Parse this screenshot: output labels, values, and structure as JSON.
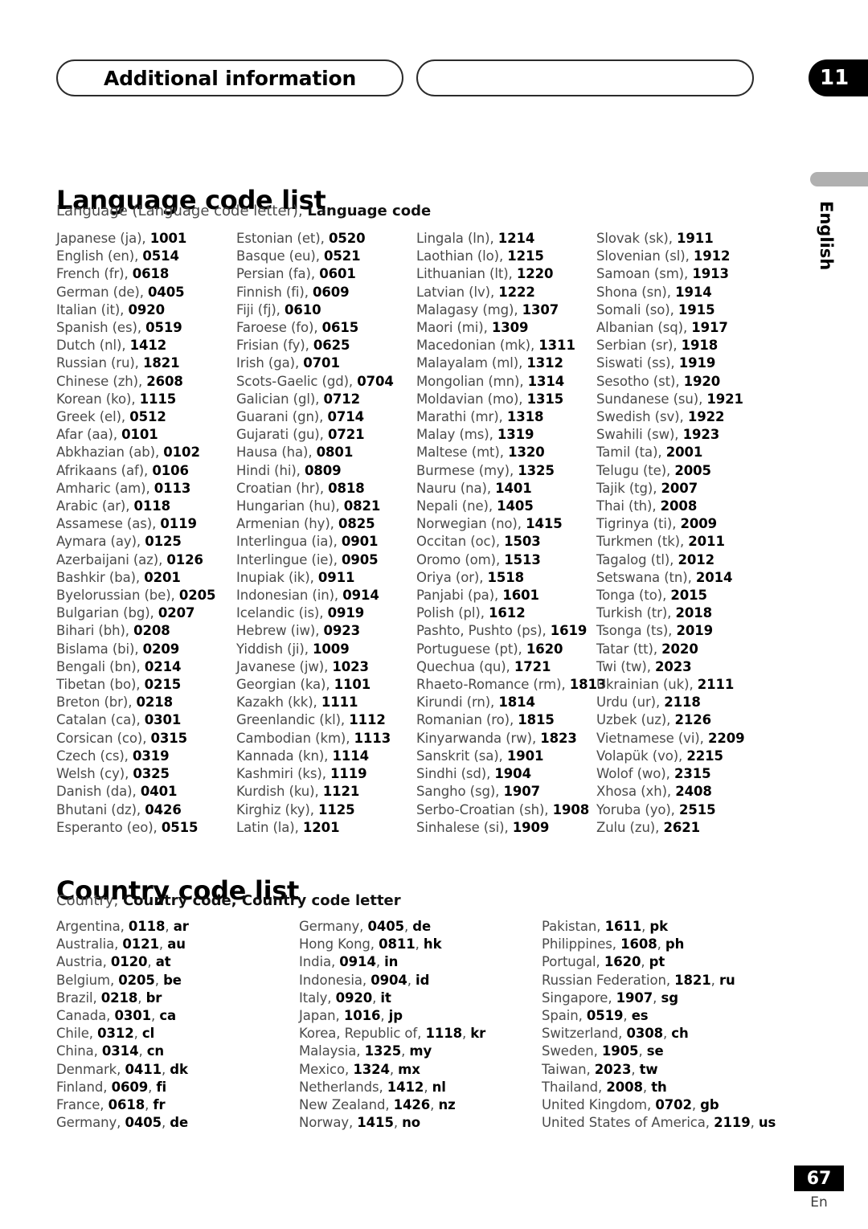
{
  "header": {
    "chapter_label": "Additional information",
    "chapter_number": "11"
  },
  "side_tab": {
    "label": "English"
  },
  "language_section": {
    "title": "Language code list",
    "subtitle_plain": "Language (Language code letter), ",
    "subtitle_bold": "Language code",
    "columns": [
      [
        {
          "name": "Japanese (ja), ",
          "code": "1001"
        },
        {
          "name": "English (en), ",
          "code": "0514"
        },
        {
          "name": "French (fr), ",
          "code": "0618"
        },
        {
          "name": "German (de), ",
          "code": "0405"
        },
        {
          "name": "Italian (it), ",
          "code": "0920"
        },
        {
          "name": "Spanish (es), ",
          "code": "0519"
        },
        {
          "name": "Dutch (nl), ",
          "code": "1412"
        },
        {
          "name": "Russian (ru), ",
          "code": "1821"
        },
        {
          "name": "Chinese (zh), ",
          "code": "2608"
        },
        {
          "name": "Korean (ko), ",
          "code": "1115"
        },
        {
          "name": "Greek (el), ",
          "code": "0512"
        },
        {
          "name": "Afar (aa), ",
          "code": "0101"
        },
        {
          "name": "Abkhazian (ab), ",
          "code": "0102"
        },
        {
          "name": "Afrikaans (af), ",
          "code": "0106"
        },
        {
          "name": "Amharic (am), ",
          "code": "0113"
        },
        {
          "name": "Arabic (ar), ",
          "code": "0118"
        },
        {
          "name": "Assamese (as), ",
          "code": "0119"
        },
        {
          "name": "Aymara (ay), ",
          "code": "0125"
        },
        {
          "name": "Azerbaijani (az), ",
          "code": "0126"
        },
        {
          "name": "Bashkir (ba), ",
          "code": "0201"
        },
        {
          "name": "Byelorussian (be), ",
          "code": "0205"
        },
        {
          "name": "Bulgarian (bg), ",
          "code": "0207"
        },
        {
          "name": "Bihari (bh), ",
          "code": "0208"
        },
        {
          "name": "Bislama (bi), ",
          "code": "0209"
        },
        {
          "name": "Bengali (bn), ",
          "code": "0214"
        },
        {
          "name": "Tibetan (bo), ",
          "code": "0215"
        },
        {
          "name": "Breton (br), ",
          "code": "0218"
        },
        {
          "name": "Catalan (ca), ",
          "code": "0301"
        },
        {
          "name": "Corsican (co), ",
          "code": "0315"
        },
        {
          "name": "Czech (cs), ",
          "code": "0319"
        },
        {
          "name": "Welsh (cy), ",
          "code": "0325"
        },
        {
          "name": "Danish (da), ",
          "code": "0401"
        },
        {
          "name": "Bhutani (dz), ",
          "code": "0426"
        },
        {
          "name": "Esperanto (eo), ",
          "code": "0515"
        }
      ],
      [
        {
          "name": "Estonian (et), ",
          "code": "0520"
        },
        {
          "name": "Basque (eu), ",
          "code": "0521"
        },
        {
          "name": "Persian (fa), ",
          "code": "0601"
        },
        {
          "name": "Finnish (fi), ",
          "code": "0609"
        },
        {
          "name": "Fiji (fj), ",
          "code": "0610"
        },
        {
          "name": "Faroese (fo), ",
          "code": "0615"
        },
        {
          "name": "Frisian (fy), ",
          "code": "0625"
        },
        {
          "name": "Irish (ga), ",
          "code": "0701"
        },
        {
          "name": "Scots-Gaelic (gd), ",
          "code": "0704"
        },
        {
          "name": "Galician (gl), ",
          "code": "0712"
        },
        {
          "name": "Guarani (gn), ",
          "code": "0714"
        },
        {
          "name": "Gujarati (gu), ",
          "code": "0721"
        },
        {
          "name": "Hausa (ha), ",
          "code": "0801"
        },
        {
          "name": "Hindi (hi), ",
          "code": "0809"
        },
        {
          "name": "Croatian (hr), ",
          "code": "0818"
        },
        {
          "name": "Hungarian (hu), ",
          "code": "0821"
        },
        {
          "name": "Armenian (hy), ",
          "code": "0825"
        },
        {
          "name": "Interlingua (ia), ",
          "code": "0901"
        },
        {
          "name": "Interlingue (ie), ",
          "code": "0905"
        },
        {
          "name": "Inupiak (ik), ",
          "code": "0911"
        },
        {
          "name": "Indonesian (in), ",
          "code": "0914"
        },
        {
          "name": "Icelandic (is), ",
          "code": "0919"
        },
        {
          "name": "Hebrew (iw), ",
          "code": "0923"
        },
        {
          "name": "Yiddish (ji), ",
          "code": "1009"
        },
        {
          "name": "Javanese (jw), ",
          "code": "1023"
        },
        {
          "name": "Georgian (ka), ",
          "code": "1101"
        },
        {
          "name": "Kazakh (kk), ",
          "code": "1111"
        },
        {
          "name": "Greenlandic  (kl), ",
          "code": "1112"
        },
        {
          "name": "Cambodian (km), ",
          "code": "1113"
        },
        {
          "name": "Kannada (kn), ",
          "code": "1114"
        },
        {
          "name": "Kashmiri (ks), ",
          "code": "1119"
        },
        {
          "name": "Kurdish (ku), ",
          "code": "1121"
        },
        {
          "name": "Kirghiz (ky), ",
          "code": "1125"
        },
        {
          "name": "Latin (la), ",
          "code": "1201"
        }
      ],
      [
        {
          "name": "Lingala (ln), ",
          "code": "1214"
        },
        {
          "name": "Laothian (lo), ",
          "code": "1215"
        },
        {
          "name": "Lithuanian (lt), ",
          "code": "1220"
        },
        {
          "name": "Latvian (lv), ",
          "code": "1222"
        },
        {
          "name": "Malagasy (mg), ",
          "code": "1307"
        },
        {
          "name": "Maori (mi), ",
          "code": "1309"
        },
        {
          "name": "Macedonian (mk), ",
          "code": "1311"
        },
        {
          "name": "Malayalam  (ml), ",
          "code": "1312"
        },
        {
          "name": "Mongolian (mn), ",
          "code": "1314"
        },
        {
          "name": "Moldavian (mo), ",
          "code": "1315"
        },
        {
          "name": "Marathi (mr), ",
          "code": "1318"
        },
        {
          "name": "Malay  (ms), ",
          "code": "1319"
        },
        {
          "name": "Maltese (mt), ",
          "code": "1320"
        },
        {
          "name": "Burmese (my), ",
          "code": "1325"
        },
        {
          "name": "Nauru (na), ",
          "code": "1401"
        },
        {
          "name": "Nepali (ne), ",
          "code": "1405"
        },
        {
          "name": "Norwegian (no), ",
          "code": "1415"
        },
        {
          "name": "Occitan (oc), ",
          "code": "1503"
        },
        {
          "name": "Oromo (om), ",
          "code": "1513"
        },
        {
          "name": "Oriya (or), ",
          "code": "1518"
        },
        {
          "name": "Panjabi (pa), ",
          "code": "1601"
        },
        {
          "name": "Polish (pl), ",
          "code": "1612"
        },
        {
          "name": "Pashto, Pushto (ps), ",
          "code": "1619"
        },
        {
          "name": "Portuguese (pt), ",
          "code": "1620"
        },
        {
          "name": "Quechua (qu), ",
          "code": "1721"
        },
        {
          "name": "Rhaeto-Romance (rm), ",
          "code": "1813"
        },
        {
          "name": "Kirundi (rn), ",
          "code": "1814"
        },
        {
          "name": "Romanian (ro), ",
          "code": "1815"
        },
        {
          "name": "Kinyarwanda (rw), ",
          "code": "1823"
        },
        {
          "name": "Sanskrit (sa), ",
          "code": "1901"
        },
        {
          "name": "Sindhi (sd), ",
          "code": "1904"
        },
        {
          "name": "Sangho (sg), ",
          "code": "1907"
        },
        {
          "name": "Serbo-Croatian (sh), ",
          "code": "1908"
        },
        {
          "name": "Sinhalese (si), ",
          "code": "1909"
        }
      ],
      [
        {
          "name": "Slovak (sk), ",
          "code": "1911"
        },
        {
          "name": "Slovenian (sl), ",
          "code": "1912"
        },
        {
          "name": "Samoan (sm), ",
          "code": "1913"
        },
        {
          "name": "Shona (sn), ",
          "code": "1914"
        },
        {
          "name": "Somali (so), ",
          "code": "1915"
        },
        {
          "name": "Albanian (sq), ",
          "code": "1917"
        },
        {
          "name": "Serbian (sr), ",
          "code": "1918"
        },
        {
          "name": "Siswati (ss), ",
          "code": "1919"
        },
        {
          "name": "Sesotho (st), ",
          "code": "1920"
        },
        {
          "name": "Sundanese (su), ",
          "code": "1921"
        },
        {
          "name": "Swedish (sv), ",
          "code": "1922"
        },
        {
          "name": "Swahili (sw), ",
          "code": "1923"
        },
        {
          "name": "Tamil (ta), ",
          "code": "2001"
        },
        {
          "name": "Telugu (te), ",
          "code": "2005"
        },
        {
          "name": "Tajik (tg), ",
          "code": "2007"
        },
        {
          "name": "Thai (th), ",
          "code": "2008"
        },
        {
          "name": "Tigrinya (ti), ",
          "code": "2009"
        },
        {
          "name": "Turkmen (tk), ",
          "code": "2011"
        },
        {
          "name": "Tagalog (tl), ",
          "code": "2012"
        },
        {
          "name": "Setswana (tn), ",
          "code": "2014"
        },
        {
          "name": "Tonga (to), ",
          "code": "2015"
        },
        {
          "name": "Turkish (tr), ",
          "code": "2018"
        },
        {
          "name": "Tsonga (ts), ",
          "code": "2019"
        },
        {
          "name": "Tatar (tt), ",
          "code": "2020"
        },
        {
          "name": "Twi (tw), ",
          "code": "2023"
        },
        {
          "name": "Ukrainian (uk), ",
          "code": "2111"
        },
        {
          "name": "Urdu (ur), ",
          "code": "2118"
        },
        {
          "name": "Uzbek (uz), ",
          "code": "2126"
        },
        {
          "name": "Vietnamese (vi), ",
          "code": "2209"
        },
        {
          "name": "Volapük (vo), ",
          "code": "2215"
        },
        {
          "name": "Wolof (wo), ",
          "code": "2315"
        },
        {
          "name": "Xhosa (xh), ",
          "code": "2408"
        },
        {
          "name": "Yoruba (yo), ",
          "code": "2515"
        },
        {
          "name": "Zulu (zu), ",
          "code": "2621"
        }
      ]
    ]
  },
  "country_section": {
    "title": "Country code list",
    "subtitle_plain": "Country, ",
    "subtitle_bold": "Country code, Country code letter",
    "columns": [
      [
        {
          "name": "Argentina, ",
          "code": "0118",
          "letter": "ar"
        },
        {
          "name": "Australia, ",
          "code": "0121",
          "letter": "au"
        },
        {
          "name": "Austria, ",
          "code": "0120",
          "letter": "at"
        },
        {
          "name": "Belgium, ",
          "code": "0205",
          "letter": "be"
        },
        {
          "name": "Brazil, ",
          "code": "0218",
          "letter": "br"
        },
        {
          "name": "Canada, ",
          "code": "0301",
          "letter": "ca"
        },
        {
          "name": "Chile, ",
          "code": "0312",
          "letter": "cl"
        },
        {
          "name": "China, ",
          "code": "0314",
          "letter": "cn"
        },
        {
          "name": "Denmark, ",
          "code": "0411",
          "letter": "dk"
        },
        {
          "name": "Finland, ",
          "code": "0609",
          "letter": "fi"
        },
        {
          "name": "France, ",
          "code": "0618",
          "letter": "fr"
        },
        {
          "name": "Germany, ",
          "code": "0405",
          "letter": "de"
        }
      ],
      [
        {
          "name": "Germany, ",
          "code": "0405",
          "letter": "de"
        },
        {
          "name": "Hong Kong, ",
          "code": "0811",
          "letter": "hk"
        },
        {
          "name": "India, ",
          "code": "0914",
          "letter": "in"
        },
        {
          "name": "Indonesia, ",
          "code": "0904",
          "letter": "id"
        },
        {
          "name": "Italy, ",
          "code": "0920",
          "letter": "it"
        },
        {
          "name": "Japan, ",
          "code": "1016",
          "letter": "jp"
        },
        {
          "name": "Korea, Republic of, ",
          "code": "1118",
          "letter": "kr"
        },
        {
          "name": "Malaysia, ",
          "code": "1325",
          "letter": "my"
        },
        {
          "name": "Mexico, ",
          "code": "1324",
          "letter": "mx"
        },
        {
          "name": "Netherlands, ",
          "code": "1412",
          "letter": "nl"
        },
        {
          "name": "New Zealand, ",
          "code": "1426",
          "letter": "nz"
        },
        {
          "name": "Norway, ",
          "code": "1415",
          "letter": "no"
        }
      ],
      [
        {
          "name": "Pakistan, ",
          "code": "1611",
          "letter": "pk"
        },
        {
          "name": "Philippines, ",
          "code": "1608",
          "letter": "ph"
        },
        {
          "name": "Portugal, ",
          "code": "1620",
          "letter": "pt"
        },
        {
          "name": "Russian Federation, ",
          "code": "1821",
          "letter": "ru"
        },
        {
          "name": "Singapore, ",
          "code": "1907",
          "letter": "sg"
        },
        {
          "name": "Spain, ",
          "code": "0519",
          "letter": "es"
        },
        {
          "name": "Switzerland, ",
          "code": "0308",
          "letter": "ch"
        },
        {
          "name": "Sweden, ",
          "code": "1905",
          "letter": "se"
        },
        {
          "name": "Taiwan, ",
          "code": "2023",
          "letter": "tw"
        },
        {
          "name": "Thailand, ",
          "code": "2008",
          "letter": "th"
        },
        {
          "name": "United Kingdom, ",
          "code": "0702",
          "letter": "gb"
        },
        {
          "name": "United States of America, ",
          "code": "2119",
          "letter": "us"
        }
      ]
    ]
  },
  "footer": {
    "page_number": "67",
    "language_mark": "En"
  }
}
